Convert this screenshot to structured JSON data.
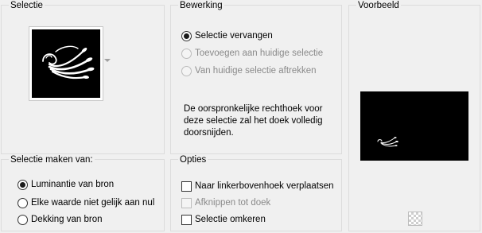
{
  "selectie": {
    "title": "Selectie"
  },
  "bewerking": {
    "title": "Bewerking",
    "options": [
      {
        "label": "Selectie vervangen",
        "checked": true,
        "enabled": true
      },
      {
        "label": "Toevoegen aan huidige selectie",
        "checked": false,
        "enabled": false
      },
      {
        "label": "Van huidige selectie aftrekken",
        "checked": false,
        "enabled": false
      }
    ],
    "description": "De oorspronkelijke rechthoek voor deze selectie zal het doek volledig doorsnijden."
  },
  "voorbeeld": {
    "title": "Voorbeeld"
  },
  "maken": {
    "title": "Selectie maken van:",
    "options": [
      {
        "label": "Luminantie van bron",
        "checked": true
      },
      {
        "label": "Elke waarde niet gelijk aan nul",
        "checked": false
      },
      {
        "label": "Dekking van bron",
        "checked": false
      }
    ]
  },
  "opties": {
    "title": "Opties",
    "options": [
      {
        "label": "Naar linkerbovenhoek verplaatsen",
        "checked": false,
        "enabled": true
      },
      {
        "label": "Afknippen tot doek",
        "checked": false,
        "enabled": false
      },
      {
        "label": "Selectie omkeren",
        "checked": false,
        "enabled": true
      }
    ]
  }
}
